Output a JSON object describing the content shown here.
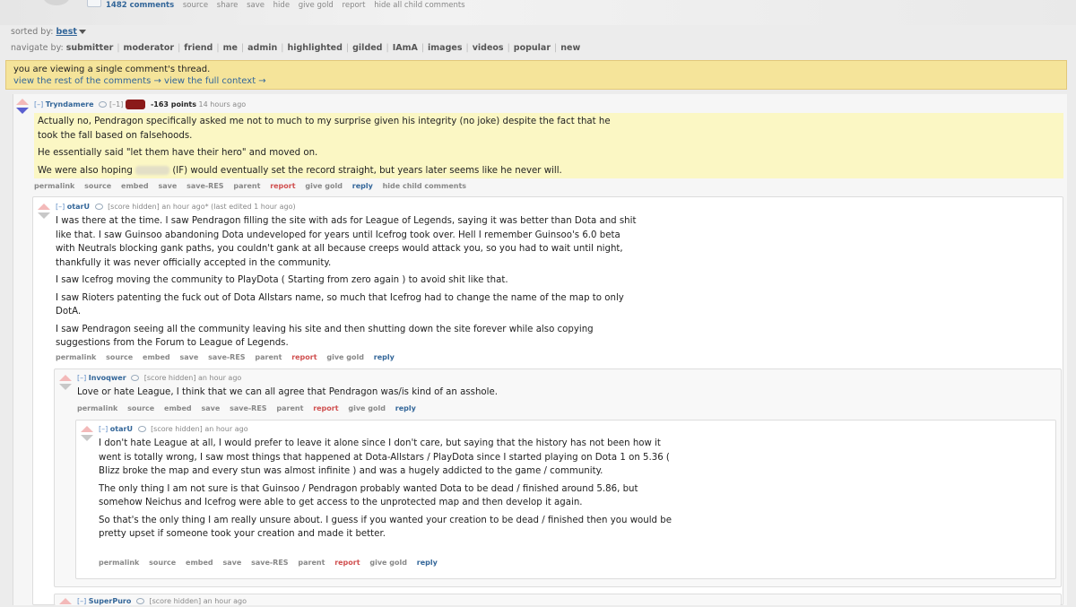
{
  "post": {
    "comments_link": "1482 comments",
    "actions": [
      "source",
      "share",
      "save",
      "hide",
      "give gold",
      "report",
      "hide all child comments"
    ]
  },
  "sort": {
    "label": "sorted by:",
    "value": "best"
  },
  "navigate": {
    "label": "navigate by:",
    "items": [
      "submitter",
      "moderator",
      "friend",
      "me",
      "admin",
      "highlighted",
      "gilded",
      "IAmA",
      "images",
      "videos",
      "popular",
      "new"
    ]
  },
  "banner": {
    "message": "you are viewing a single comment's thread.",
    "rest_link": "view the rest of the comments →",
    "context_link": "view the full context →"
  },
  "comments": [
    {
      "collapse": "[–]",
      "author": "Tryndamere",
      "flair_suffix": "[–1]",
      "points": "-163 points",
      "time": "14 hours ago",
      "paragraphs": [
        "Actually no, Pendragon specifically asked me not to much to my surprise given his integrity (no joke) despite the fact that he took the fall based on falsehoods.",
        "He essentially said \"let them have their hero\" and moved on."
      ],
      "last_para_before": "We were also hoping",
      "last_para_after": "(IF) would eventually set the record straight, but years later seems like he never will.",
      "buttons": [
        "permalink",
        "source",
        "embed",
        "save",
        "save-RES",
        "parent",
        "report",
        "give gold",
        "reply",
        "hide child comments"
      ]
    },
    {
      "collapse": "[–]",
      "author": "otarU",
      "meta": "[score hidden] an hour ago* (last edited 1 hour ago)",
      "paragraphs": [
        "I was there at the time. I saw Pendragon filling the site with ads for League of Legends, saying it was better than Dota and shit like that. I saw Guinsoo abandoning Dota undeveloped for years until Icefrog took over. Hell I remember Guinsoo's 6.0 beta with Neutrals blocking gank paths, you couldn't gank at all because creeps would attack you, so you had to wait until night, thankfully it was never officially accepted in the community.",
        "I saw Icefrog moving the community to PlayDota ( Starting from zero again ) to avoid shit like that.",
        "I saw Rioters patenting the fuck out of Dota Allstars name, so much that Icefrog had to change the name of the map to only DotA.",
        "I saw Pendragon seeing all the community leaving his site and then shutting down the site forever while also copying suggestions from the Forum to League of Legends."
      ],
      "buttons": [
        "permalink",
        "source",
        "embed",
        "save",
        "save-RES",
        "parent",
        "report",
        "give gold",
        "reply"
      ]
    },
    {
      "collapse": "[–]",
      "author": "Invoqwer",
      "meta": "[score hidden] an hour ago",
      "paragraphs": [
        "Love or hate League, I think that we can all agree that Pendragon was/is kind of an asshole."
      ],
      "buttons": [
        "permalink",
        "source",
        "embed",
        "save",
        "save-RES",
        "parent",
        "report",
        "give gold",
        "reply"
      ]
    },
    {
      "collapse": "[–]",
      "author": "otarU",
      "meta": "[score hidden] an hour ago",
      "paragraphs": [
        "I don't hate League at all, I would prefer to leave it alone since I don't care, but saying that the history has not been how it went is totally wrong, I saw most things that happened at Dota-Allstars / PlayDota since I started playing on Dota 1 on 5.36 ( Blizz broke the map and every stun was almost infinite ) and was a hugely addicted to the game / community.",
        "The only thing I am not sure is that Guinsoo / Pendragon probably wanted Dota to be dead / finished around 5.86, but somehow Neichus and Icefrog were able to get access to the unprotected map and then develop it again.",
        "So that's the only thing I am really unsure about. I guess if you wanted your creation to be dead / finished then you would be pretty upset if someone took your creation and made it better."
      ],
      "buttons": [
        "permalink",
        "source",
        "embed",
        "save",
        "save-RES",
        "parent",
        "report",
        "give gold",
        "reply"
      ]
    },
    {
      "collapse": "[–]",
      "author": "SuperPuro",
      "meta": "[score hidden] an hour ago"
    }
  ]
}
